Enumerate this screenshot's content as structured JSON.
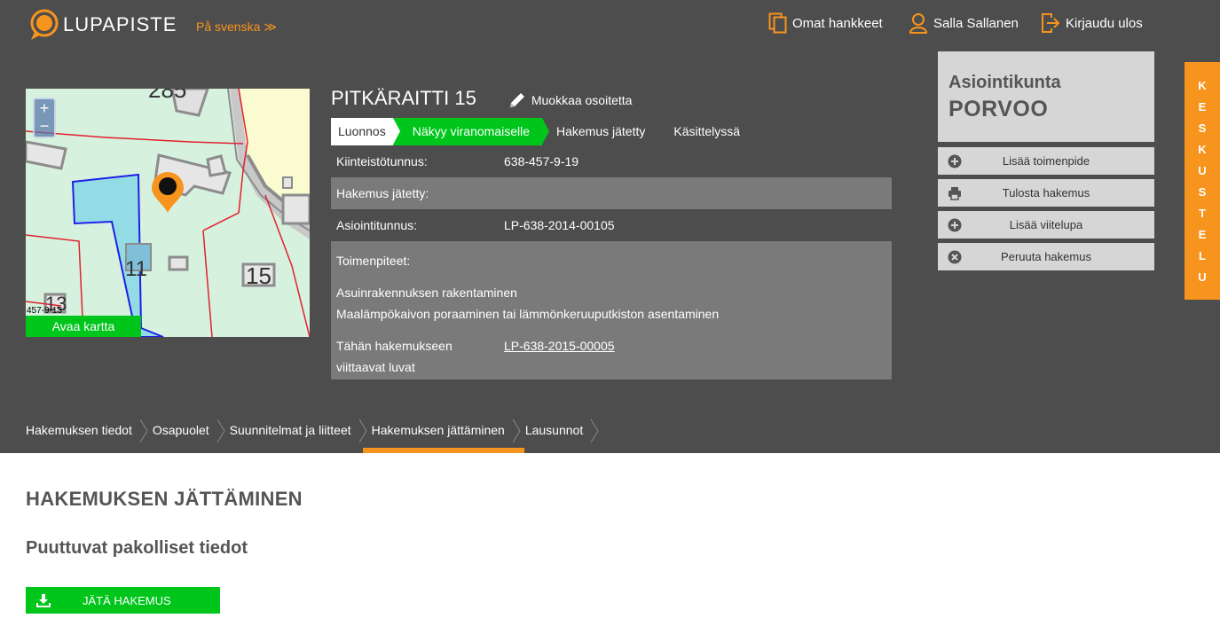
{
  "header": {
    "brand": "LUPAPISTE",
    "language_link": "På svenska ≫",
    "nav": {
      "projects": "Omat hankkeet",
      "user": "Salla Sallanen",
      "logout": "Kirjaudu ulos"
    }
  },
  "map": {
    "zoom_in": "+",
    "zoom_out": "−",
    "open_label": "Avaa kartta",
    "labels": {
      "top_number": "285",
      "lot_11": "11",
      "lot_15": "15",
      "lot_13": "13",
      "parcel_code": "457-9-13"
    }
  },
  "application": {
    "title": "PITKÄRAITTI 15",
    "edit_address": "Muokkaa osoitetta",
    "states": [
      "Luonnos",
      "Näkyy viranomaiselle",
      "Hakemus jätetty",
      "Käsittelyssä"
    ],
    "info": {
      "property_id_label": "Kiinteistötunnus:",
      "property_id": "638-457-9-19",
      "submitted_label": "Hakemus jätetty:",
      "submitted": "",
      "reference_label": "Asiointitunnus:",
      "reference": "LP-638-2014-00105",
      "operations_label": "Toimenpiteet:",
      "operations": [
        "Asuinrakennuksen rakentaminen",
        "Maalämpökaivon poraaminen tai lämmönkeruuputkiston asentaminen"
      ],
      "linked_label_1": "Tähän hakemukseen",
      "linked_label_2": "viittaavat luvat",
      "linked_permit": "LP-638-2015-00005"
    }
  },
  "authority": {
    "label": "Asiointikunta",
    "name": "PORVOO"
  },
  "actions": {
    "add_operation": "Lisää toimenpide",
    "print": "Tulosta hakemus",
    "add_reference": "Lisää viitelupa",
    "cancel": "Peruuta hakemus"
  },
  "chat_tab": [
    "K",
    "E",
    "S",
    "K",
    "U",
    "S",
    "T",
    "E",
    "L",
    "U"
  ],
  "tabs": [
    "Hakemuksen tiedot",
    "Osapuolet",
    "Suunnitelmat ja liitteet",
    "Hakemuksen jättäminen",
    "Lausunnot"
  ],
  "main": {
    "heading": "HAKEMUKSEN JÄTTÄMINEN",
    "subheading": "Puuttuvat pakolliset tiedot",
    "submit_button": "JÄTÄ HAKEMUS"
  },
  "colors": {
    "background_dark": "#4d4d4d",
    "accent_orange": "#f7941d",
    "accent_green": "#00c61b",
    "panel_grey": "#d6d6d6"
  }
}
